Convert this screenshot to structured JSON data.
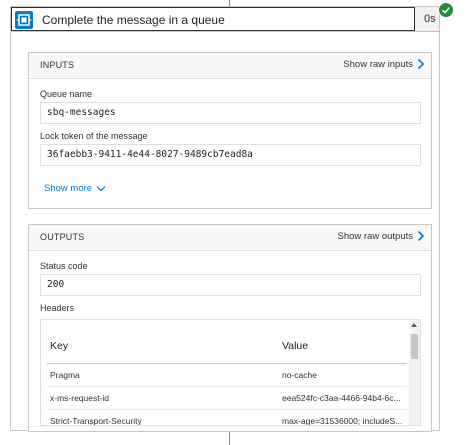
{
  "action": {
    "title": "Complete the message in a queue",
    "duration": "0s"
  },
  "inputs": {
    "section_title": "INPUTS",
    "show_raw_label": "Show raw inputs",
    "fields": [
      {
        "label": "Queue name",
        "value": "sbq-messages"
      },
      {
        "label": "Lock token of the message",
        "value": "36faebb3-9411-4e44-8027-9489cb7ead8a"
      }
    ],
    "show_more_label": "Show more"
  },
  "outputs": {
    "section_title": "OUTPUTS",
    "show_raw_label": "Show raw outputs",
    "status_code_label": "Status code",
    "status_code_value": "200",
    "headers_label": "Headers",
    "headers_table": {
      "columns": [
        "Key",
        "Value"
      ],
      "rows": [
        {
          "key": "Pragma",
          "value": "no-cache"
        },
        {
          "key": "x-ms-request-id",
          "value": "eea524fc-c3aa-4466-94b4-6c..."
        },
        {
          "key": "Strict-Transport-Security",
          "value": "max-age=31536000; includeS..."
        }
      ]
    }
  },
  "colors": {
    "accent": "#0078d4",
    "icon_bg": "#0a7bc1",
    "success": "#218a3b"
  }
}
